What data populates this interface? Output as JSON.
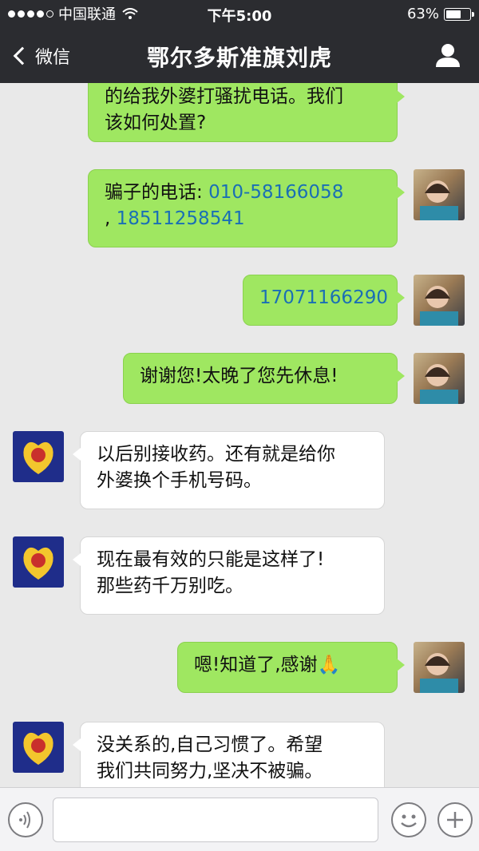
{
  "status": {
    "carrier": "中国联通",
    "time": "下午5:00",
    "battery": "63%",
    "battery_level": 0.63
  },
  "nav": {
    "back_label": "微信",
    "title": "鄂尔多斯准旗刘虎"
  },
  "messages": [
    {
      "side": "right",
      "color": "green",
      "lines": [
        "的给我外婆打骚扰电话。我们",
        "该如何处置?"
      ]
    },
    {
      "side": "right",
      "color": "green",
      "prefix": "骗子的电话:",
      "phone1": "010-58166058",
      "sep": ",",
      "phone2": "18511258541"
    },
    {
      "side": "right",
      "color": "green",
      "phone": "17071166290"
    },
    {
      "side": "right",
      "color": "green",
      "text": "谢谢您!太晚了您先休息!"
    },
    {
      "side": "left",
      "color": "white",
      "lines": [
        "以后别接收药。还有就是给你",
        "外婆换个手机号码。"
      ]
    },
    {
      "side": "left",
      "color": "white",
      "lines": [
        "现在最有效的只能是这样了!",
        "那些药千万别吃。"
      ]
    },
    {
      "side": "right",
      "color": "green",
      "text": "嗯!知道了,感谢🙏"
    },
    {
      "side": "left",
      "color": "white",
      "lines": [
        "没关系的,自己习惯了。希望",
        "我们共同努力,坚决不被骗。"
      ]
    }
  ],
  "input": {
    "placeholder": ""
  },
  "icons": {
    "voice": "voice-icon",
    "emoji": "emoji-icon",
    "add": "plus-icon",
    "profile": "person-icon"
  }
}
